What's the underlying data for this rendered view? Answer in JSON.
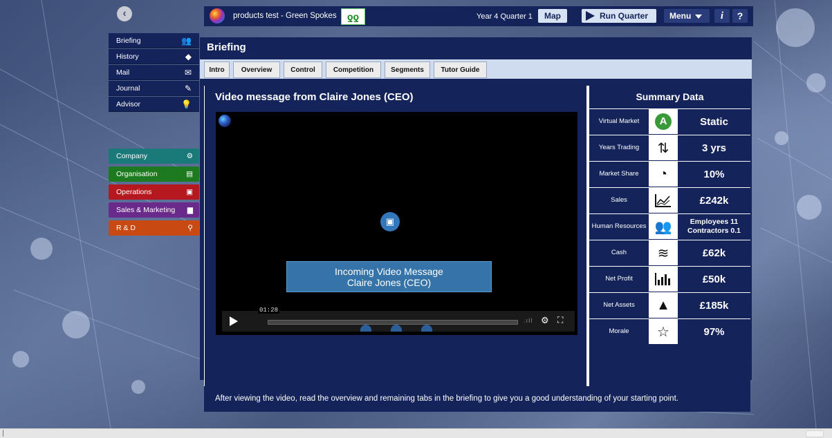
{
  "app": {
    "title": "products test - Green Spokes",
    "quarter": "Year 4 Quarter 1",
    "map_label": "Map",
    "run_label": "Run Quarter",
    "menu_label": "Menu",
    "info_label": "i",
    "help_label": "?"
  },
  "nav_primary": [
    {
      "label": "Briefing",
      "icon": "team-icon",
      "glyph": "👥"
    },
    {
      "label": "History",
      "icon": "signpost-icon",
      "glyph": "◆"
    },
    {
      "label": "Mail",
      "icon": "envelope-icon",
      "glyph": "✉"
    },
    {
      "label": "Journal",
      "icon": "pencil-icon",
      "glyph": "✎"
    },
    {
      "label": "Advisor",
      "icon": "lightbulb-icon",
      "glyph": "💡"
    }
  ],
  "nav_secondary": [
    {
      "label": "Company",
      "icon": "gears-icon",
      "glyph": "⚙",
      "color": "#1a7a7a"
    },
    {
      "label": "Organisation",
      "icon": "clipboard-icon",
      "glyph": "▤",
      "color": "#1e7a1e"
    },
    {
      "label": "Operations",
      "icon": "truck-icon",
      "glyph": "▣",
      "color": "#b5181e"
    },
    {
      "label": "Sales & Marketing",
      "icon": "bar-chart-icon",
      "glyph": "▆",
      "color": "#6a2a8c"
    },
    {
      "label": "R & D",
      "icon": "lamp-icon",
      "glyph": "⚲",
      "color": "#c84a12"
    }
  ],
  "panel": {
    "heading": "Briefing",
    "tabs": [
      "Intro",
      "Overview",
      "Control",
      "Competition",
      "Segments",
      "Tutor Guide"
    ]
  },
  "video": {
    "title": "Video message from Claire Jones (CEO)",
    "message_line1": "Incoming Video Message",
    "message_line2": "Claire Jones (CEO)",
    "time": "01:28",
    "caption": "After viewing the video, read the overview and remaining tabs in the briefing to give you a good understanding of your starting point."
  },
  "summary": {
    "title": "Summary Data",
    "rows": [
      {
        "label": "Virtual Market",
        "icon": "grade-a-icon",
        "glyph": "A",
        "value": "Static"
      },
      {
        "label": "Years Trading",
        "icon": "cycle-arrows-icon",
        "glyph": "⇅",
        "value": "3 yrs"
      },
      {
        "label": "Market Share",
        "icon": "pie-icon",
        "glyph": "◔",
        "value": "10%"
      },
      {
        "label": "Sales",
        "icon": "line-chart-icon",
        "glyph": "📈",
        "value": "£242k"
      },
      {
        "label": "Human Resources",
        "icon": "people-icon",
        "glyph": "👥",
        "value_line1": "Employees 11",
        "value_line2": "Contractors 0.1"
      },
      {
        "label": "Cash",
        "icon": "coins-icon",
        "glyph": "≋",
        "value": "£62k"
      },
      {
        "label": "Net Profit",
        "icon": "bar-chart-icon",
        "glyph": "▁▃▆",
        "value": "£50k"
      },
      {
        "label": "Net Assets",
        "icon": "pyramid-icon",
        "glyph": "▲",
        "value": "£185k"
      },
      {
        "label": "Morale",
        "icon": "star-icon",
        "glyph": "☆",
        "value": "97%"
      }
    ]
  }
}
